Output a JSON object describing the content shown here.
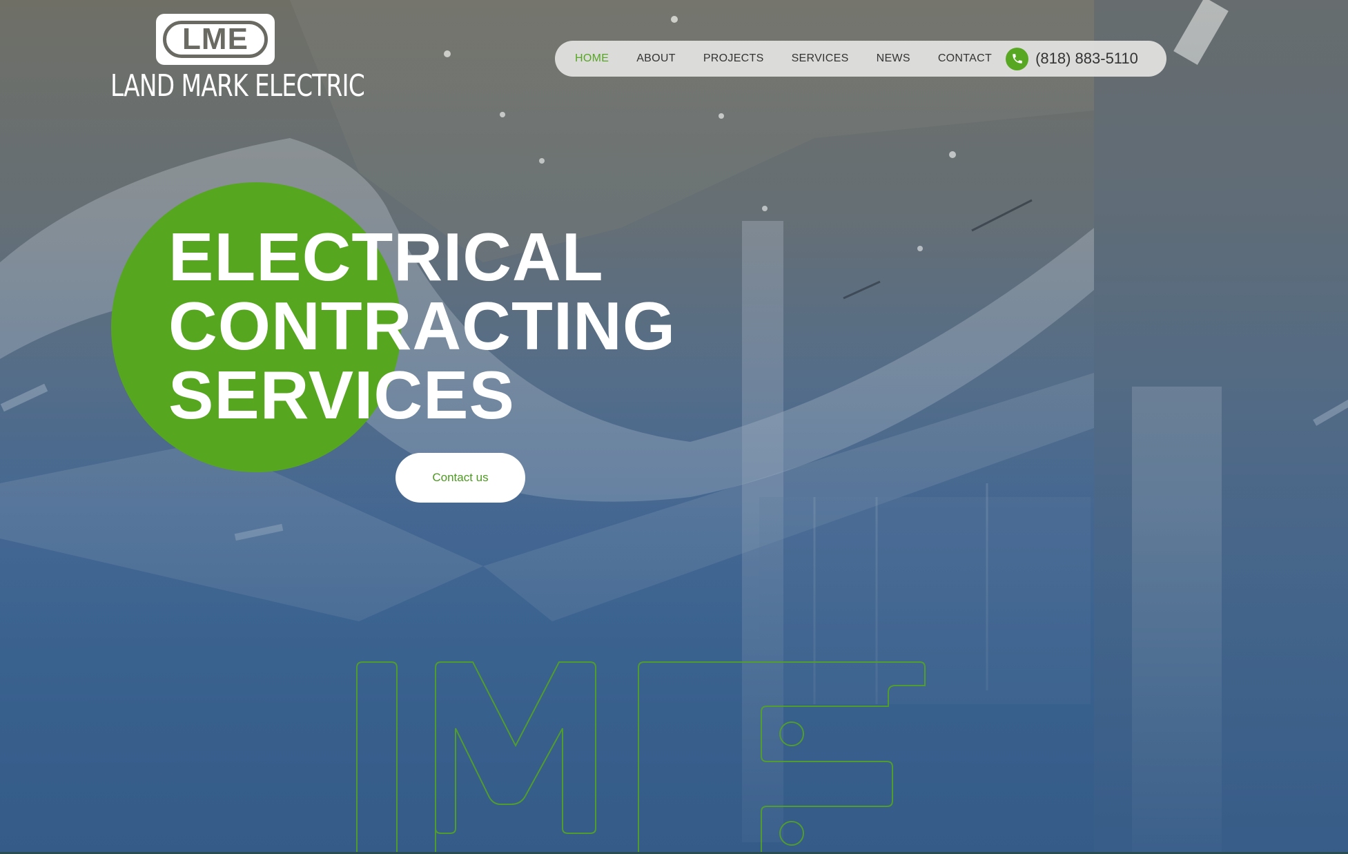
{
  "logo": {
    "badge_text": "LME",
    "company_name": "LAND MARK ELECTRIC"
  },
  "nav": {
    "items": [
      {
        "label": "HOME",
        "active": true
      },
      {
        "label": "ABOUT",
        "active": false
      },
      {
        "label": "PROJECTS",
        "active": false
      },
      {
        "label": "SERVICES",
        "active": false
      },
      {
        "label": "NEWS",
        "active": false
      },
      {
        "label": "CONTACT",
        "active": false
      }
    ],
    "phone": {
      "icon": "phone-icon",
      "number": "(818) 883-5110"
    }
  },
  "hero": {
    "title_lines": [
      "ELECTRICAL",
      "CONTRACTING",
      "SERVICES"
    ],
    "cta_label": "Contact us"
  },
  "colors": {
    "accent_green": "#56a71f",
    "nav_background": "#e4e4e2",
    "text_dark": "#333333",
    "white": "#ffffff",
    "bg_top": "#6f6f66",
    "bg_bottom": "#365c89"
  }
}
